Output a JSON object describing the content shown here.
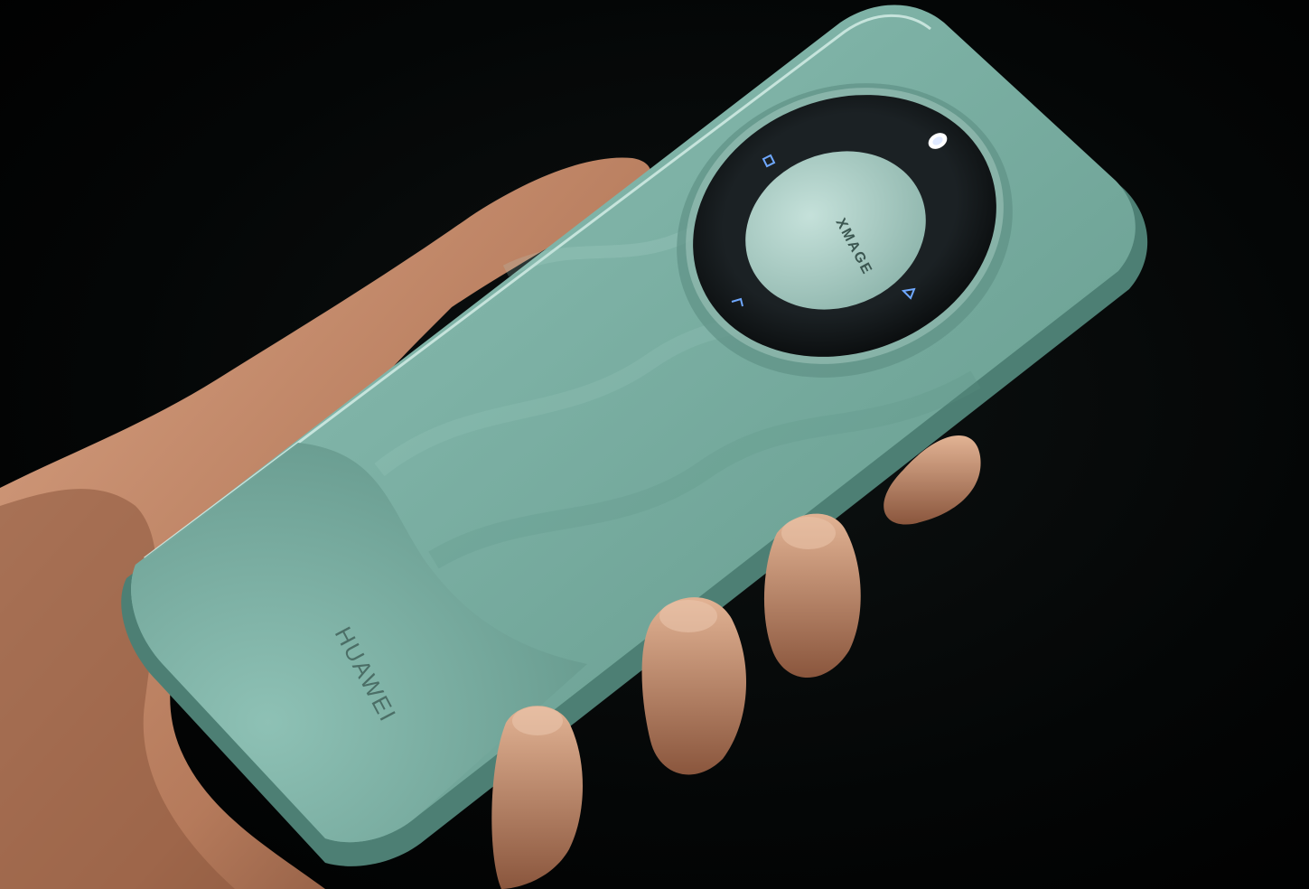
{
  "photo": {
    "subject": "phone-back-held-in-hand",
    "back_brand": "HUAWEI",
    "camera_ring_mark": "XMAGE",
    "colors": {
      "background": "#000000",
      "phone_body": "#7fb3a7",
      "phone_highlight": "#b9ddd4",
      "phone_shadow": "#3f6d64",
      "camera_ring": "#151a1c",
      "camera_center": "#a9cbc2",
      "skin": "#c9906f",
      "skin_shadow": "#6b3f2b",
      "flash_led": "#ffffff"
    },
    "icons": [
      "flash-icon",
      "sensor-icon-top",
      "sensor-icon-left",
      "sensor-icon-right"
    ]
  }
}
